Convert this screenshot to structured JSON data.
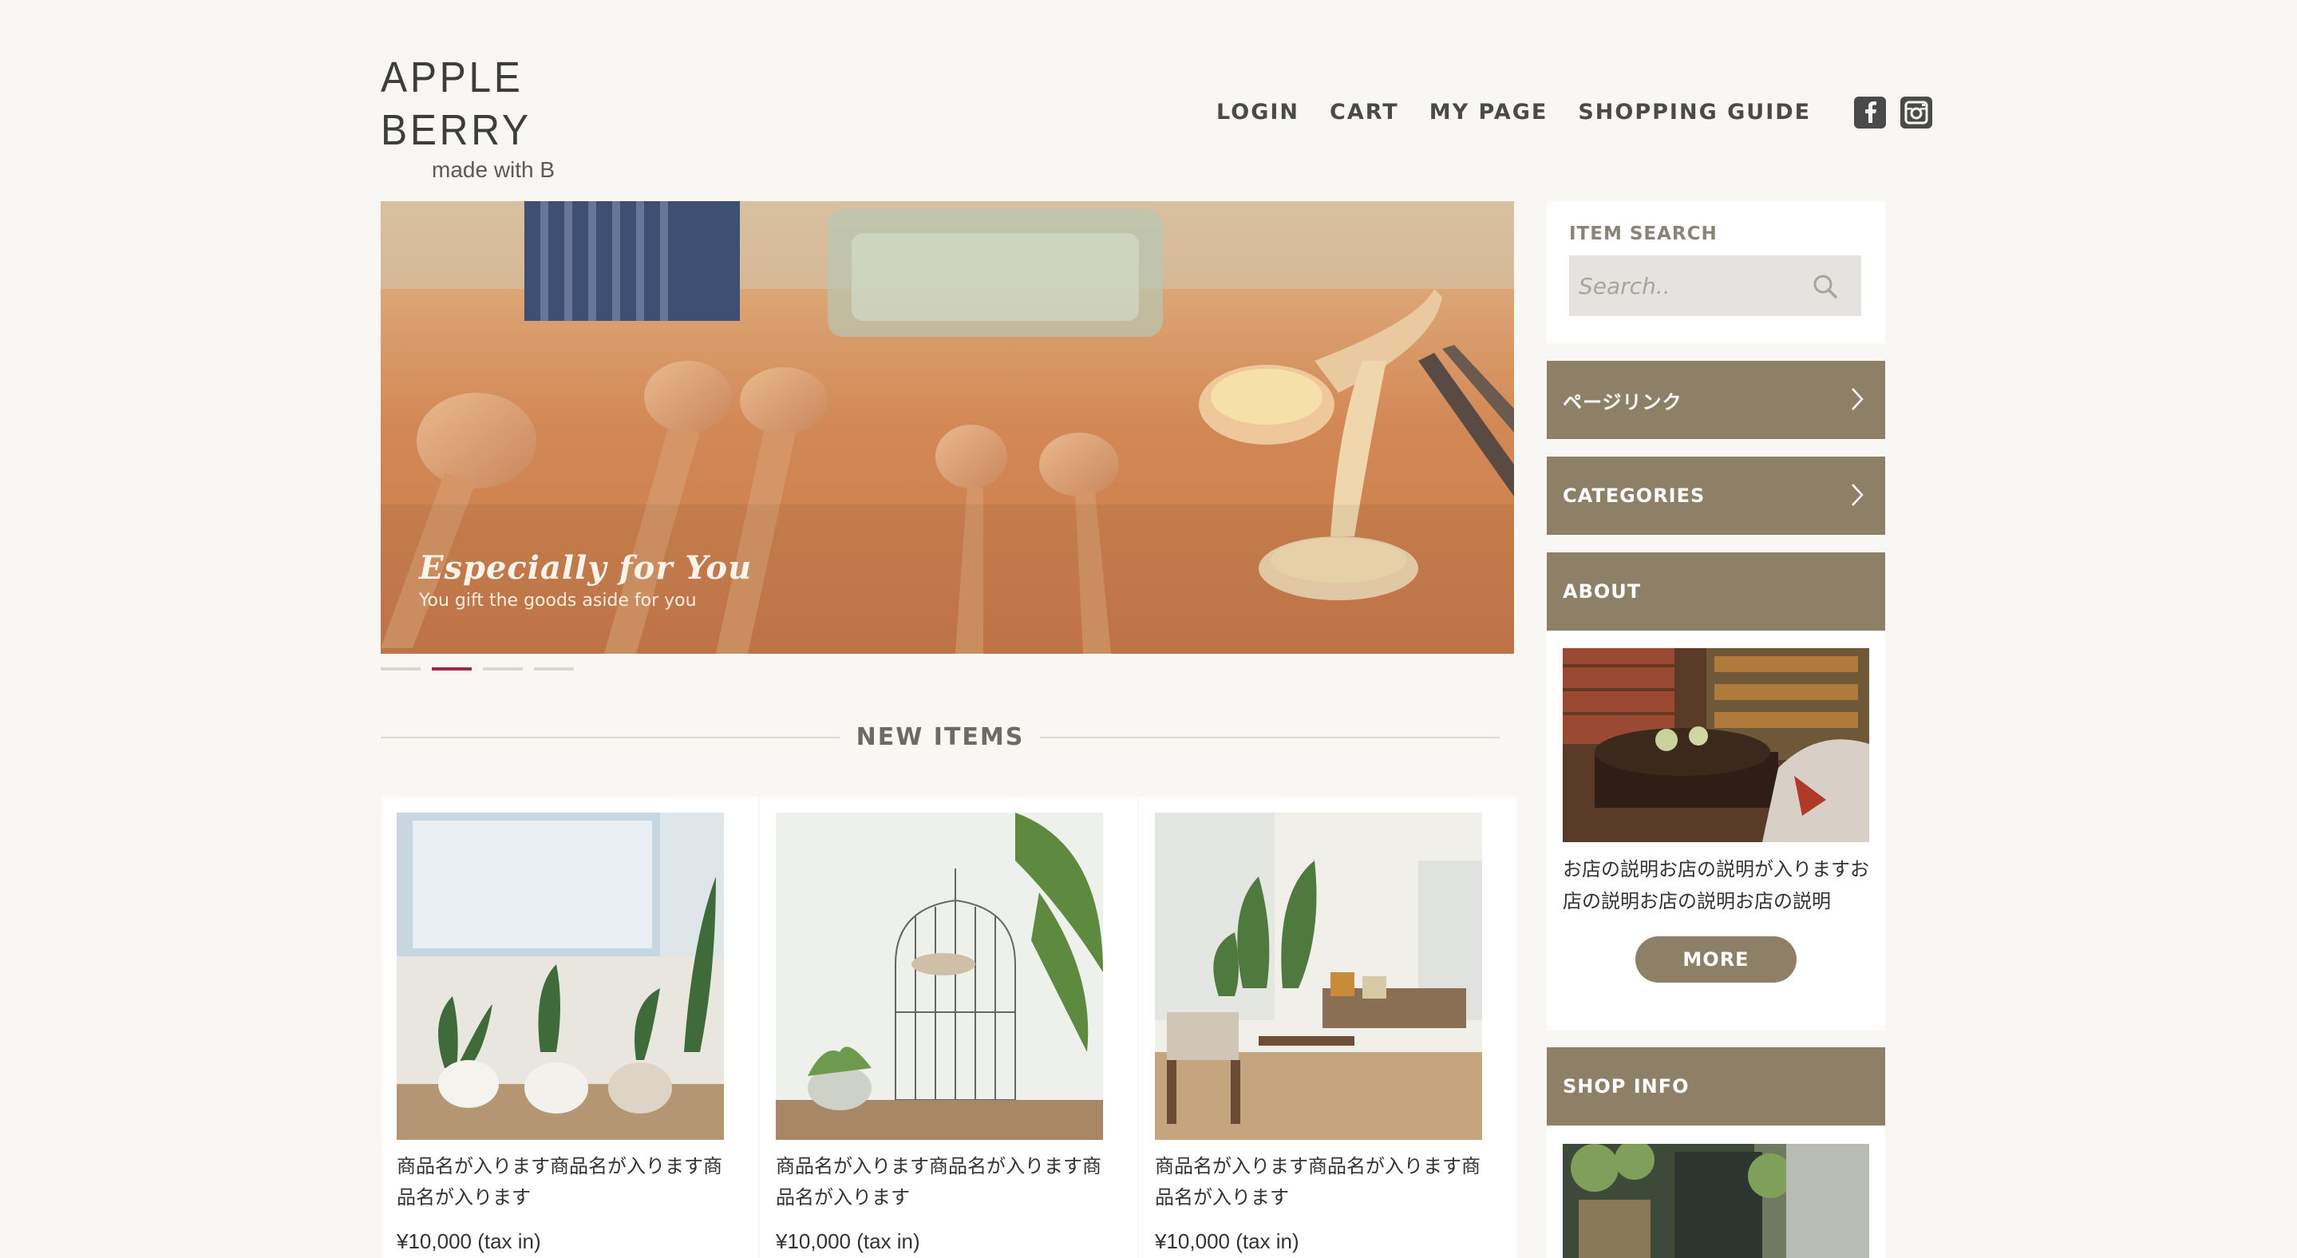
{
  "header": {
    "logo_title": "APPLE BERRY",
    "logo_sub": "made with B",
    "nav": [
      "LOGIN",
      "CART",
      "MY PAGE",
      "SHOPPING GUIDE"
    ],
    "social_icons": [
      "facebook-icon",
      "instagram-icon"
    ]
  },
  "hero": {
    "title": "Especially for You",
    "subtitle": "You gift the goods aside for you",
    "slide_count": 4,
    "active_slide": 2
  },
  "new_items": {
    "title": "NEW ITEMS",
    "items": [
      {
        "name": "商品名が入ります商品名が入ります商品名が入ります",
        "price": "¥10,000 (tax in)"
      },
      {
        "name": "商品名が入ります商品名が入ります商品名が入ります",
        "price": "¥10,000 (tax in)"
      },
      {
        "name": "商品名が入ります商品名が入ります商品名が入ります",
        "price": "¥10,000 (tax in)"
      }
    ]
  },
  "sidebar": {
    "search_label": "ITEM SEARCH",
    "search_placeholder": "Search..",
    "page_link": "ページリンク",
    "categories": "CATEGORIES",
    "about_title": "ABOUT",
    "about_text": "お店の説明お店の説明が入りますお店の説明お店の説明お店の説明",
    "more_label": "MORE",
    "shop_info_title": "SHOP INFO"
  },
  "colors": {
    "background": "#f8f7f3",
    "accent": "#8d8067",
    "active_dot": "#a0283a"
  }
}
